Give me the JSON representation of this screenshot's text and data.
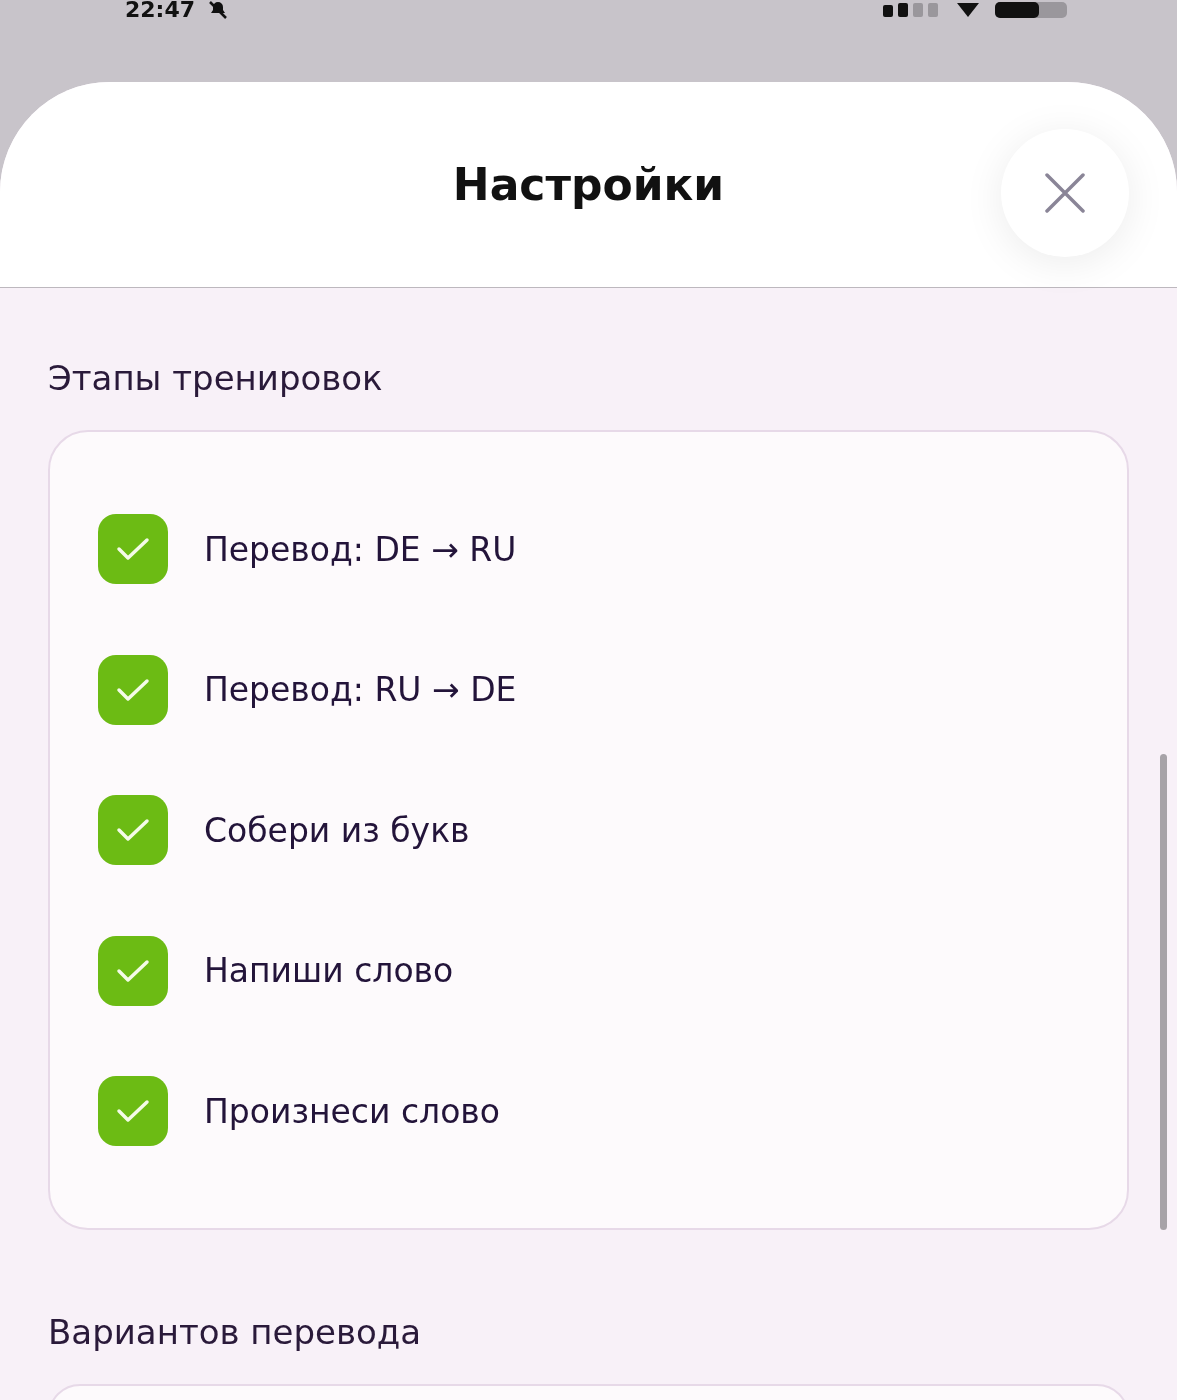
{
  "status_bar": {
    "time": "22:47"
  },
  "header": {
    "title": "Настройки"
  },
  "sections": [
    {
      "title": "Этапы тренировок",
      "options": [
        {
          "label": "Перевод: DE → RU",
          "checked": true
        },
        {
          "label": "Перевод: RU → DE",
          "checked": true
        },
        {
          "label": "Собери из букв",
          "checked": true
        },
        {
          "label": "Напиши слово",
          "checked": true
        },
        {
          "label": "Произнеси слово",
          "checked": true
        }
      ]
    },
    {
      "title": "Вариантов перевода"
    }
  ]
}
